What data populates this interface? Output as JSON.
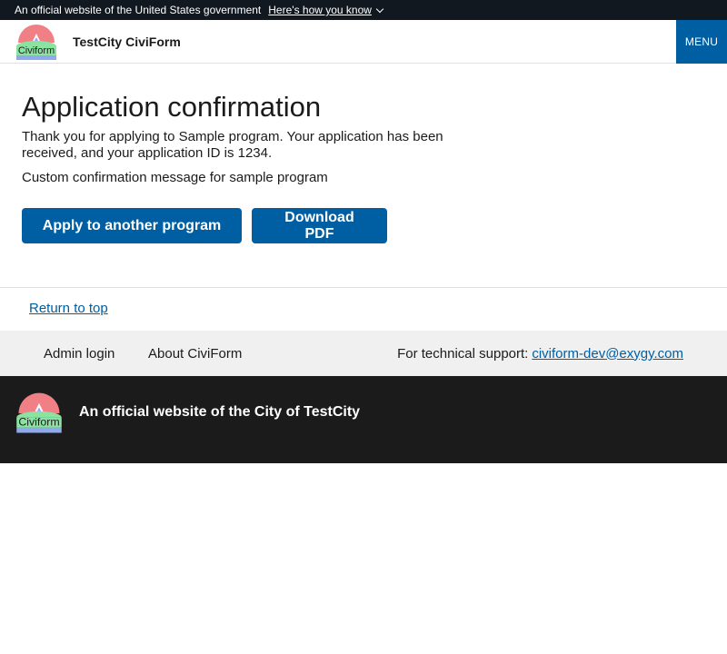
{
  "gov_banner": {
    "text": "An official website of the United States government",
    "link": "Here's how you know"
  },
  "header": {
    "logo_text": "Civiform",
    "site_title": "TestCity CiviForm",
    "menu_label": "MENU"
  },
  "main": {
    "title": "Application confirmation",
    "message": "Thank you for applying to Sample program. Your application has been received, and your application ID is 1234.",
    "custom_message": "Custom confirmation message for sample program",
    "apply_button": "Apply to another program",
    "download_button": "Download PDF"
  },
  "return_to_top": "Return to top",
  "footer_nav": {
    "admin_login": "Admin login",
    "about": "About CiviForm",
    "support_prefix": "For technical support:",
    "support_email": "civiform-dev@exygy.com"
  },
  "footer": {
    "logo_text": "Civiform",
    "official_text": "An official website of the City of TestCity"
  },
  "colors": {
    "primary": "#005ea2",
    "gov_banner_bg": "#111820",
    "footer_bg": "#1b1b1b",
    "footer_nav_bg": "#f0f0f0"
  },
  "icons": [
    "chevron-down-icon",
    "civiform-logo-icon"
  ]
}
